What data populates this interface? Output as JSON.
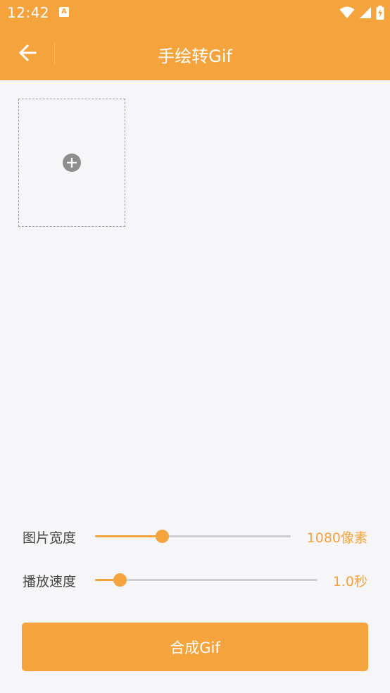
{
  "status_bar": {
    "time": "12:42",
    "notification_glyph": "A",
    "icons": [
      "wifi-icon",
      "cell-signal-icon",
      "battery-charging-icon"
    ]
  },
  "toolbar": {
    "title": "手绘转Gif",
    "back_icon": "arrow-left-icon"
  },
  "canvas": {
    "add_icon": "plus-circle-icon"
  },
  "settings": {
    "width": {
      "label": "图片宽度",
      "value_text": "1080像素",
      "slider_fraction": 0.34
    },
    "speed": {
      "label": "播放速度",
      "value_text": "1.0秒",
      "slider_fraction": 0.11
    }
  },
  "compose_button": {
    "label": "合成Gif"
  },
  "colors": {
    "accent": "#f5a33c",
    "background": "#f6f6f8",
    "track": "#cfcfd2",
    "label_text": "#444444"
  }
}
